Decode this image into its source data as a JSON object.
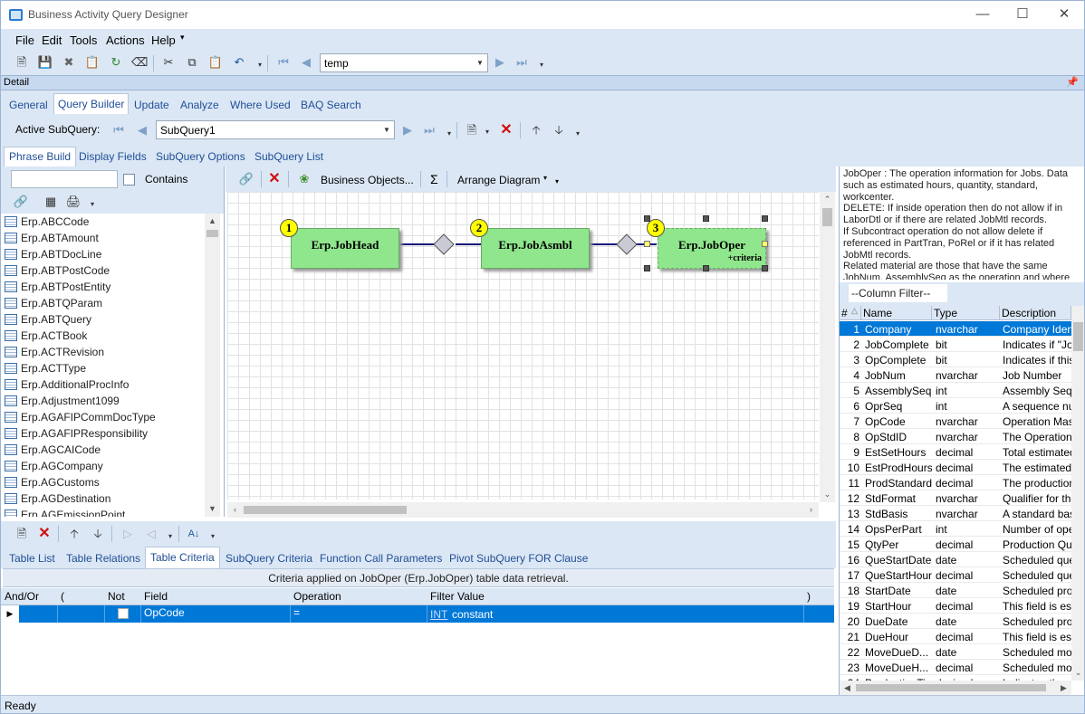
{
  "window": {
    "title": "Business Activity Query Designer"
  },
  "menu": [
    "File",
    "Edit",
    "Tools",
    "Actions",
    "Help"
  ],
  "toolbar": {
    "record_combo": "temp"
  },
  "detail_header": "Detail",
  "main_tabs": [
    "General",
    "Query Builder",
    "Update",
    "Analyze",
    "Where Used",
    "BAQ Search"
  ],
  "active_main_tab": "Query Builder",
  "subquery": {
    "label": "Active SubQuery:",
    "value": "SubQuery1"
  },
  "sub_tabs": [
    "Phrase Build",
    "Display Fields",
    "SubQuery Options",
    "SubQuery List"
  ],
  "active_sub_tab": "Phrase Build",
  "left": {
    "search_value": "",
    "contains_label": "Contains",
    "tables": [
      "Erp.ABCCode",
      "Erp.ABTAmount",
      "Erp.ABTDocLine",
      "Erp.ABTPostCode",
      "Erp.ABTPostEntity",
      "Erp.ABTQParam",
      "Erp.ABTQuery",
      "Erp.ACTBook",
      "Erp.ACTRevision",
      "Erp.ACTType",
      "Erp.AdditionalProcInfo",
      "Erp.Adjustment1099",
      "Erp.AGAFIPCommDocType",
      "Erp.AGAFIPResponsibility",
      "Erp.AGCAICode",
      "Erp.AGCompany",
      "Erp.AGCustoms",
      "Erp.AGDestination",
      "Erp.AGEmissionPoint"
    ]
  },
  "diagram": {
    "business_objects_label": "Business Objects...",
    "sigma": "Σ",
    "arrange_label": "Arrange Diagram",
    "nodes": [
      {
        "num": "1",
        "name": "Erp.JobHead",
        "extra": ""
      },
      {
        "num": "2",
        "name": "Erp.JobAsmbl",
        "extra": ""
      },
      {
        "num": "3",
        "name": "Erp.JobOper",
        "extra": "+criteria"
      }
    ]
  },
  "right": {
    "description": "JobOper : The operation information for Jobs.  Data such as estimated hours, quantity, standard, workcenter.\nDELETE: If inside operation then do not allow if in LaborDtl or if there are related JobMtl records.\nIf Subcontract operation do not allow delete if referenced in PartTran, PoRel or if it has related JobMtl records.\nRelated material are those that have the same JobNum, AssemblySeq as the operation and where",
    "column_filter": "--Column Filter--",
    "grid_headers": [
      "#",
      "Name",
      "Type",
      "Description"
    ],
    "rows": [
      [
        "1",
        "Company",
        "nvarchar",
        "Company Identifier"
      ],
      [
        "2",
        "JobComplete",
        "bit",
        "Indicates if \"Jo"
      ],
      [
        "3",
        "OpComplete",
        "bit",
        "Indicates if this"
      ],
      [
        "4",
        "JobNum",
        "nvarchar",
        "Job Number"
      ],
      [
        "5",
        "AssemblySeq",
        "int",
        "Assembly Seq"
      ],
      [
        "6",
        "OprSeq",
        "int",
        "A sequence nu"
      ],
      [
        "7",
        "OpCode",
        "nvarchar",
        "Operation Mas"
      ],
      [
        "8",
        "OpStdID",
        "nvarchar",
        "The Operation"
      ],
      [
        "9",
        "EstSetHours",
        "decimal",
        "Total estimated"
      ],
      [
        "10",
        "EstProdHours",
        "decimal",
        "The estimated"
      ],
      [
        "11",
        "ProdStandard",
        "decimal",
        "The production"
      ],
      [
        "12",
        "StdFormat",
        "nvarchar",
        "Qualifier for the"
      ],
      [
        "13",
        "StdBasis",
        "nvarchar",
        "A standard bas"
      ],
      [
        "14",
        "OpsPerPart",
        "int",
        "Number of ope"
      ],
      [
        "15",
        "QtyPer",
        "decimal",
        "Production Qu"
      ],
      [
        "16",
        "QueStartDate",
        "date",
        "Scheduled que"
      ],
      [
        "17",
        "QueStartHour",
        "decimal",
        "Scheduled que"
      ],
      [
        "18",
        "StartDate",
        "date",
        "Scheduled pro"
      ],
      [
        "19",
        "StartHour",
        "decimal",
        "This field is es"
      ],
      [
        "20",
        "DueDate",
        "date",
        "Scheduled pro"
      ],
      [
        "21",
        "DueHour",
        "decimal",
        "This field is es"
      ],
      [
        "22",
        "MoveDueD...",
        "date",
        "Scheduled mo"
      ],
      [
        "23",
        "MoveDueH...",
        "decimal",
        "Scheduled mo"
      ],
      [
        "24",
        "ProductionTi...",
        "decimal",
        "Indicates the"
      ]
    ]
  },
  "bottom": {
    "tabs": [
      "Table List",
      "Table Relations",
      "Table Criteria",
      "SubQuery Criteria",
      "Function Call Parameters",
      "Pivot SubQuery FOR Clause"
    ],
    "active_tab": "Table Criteria",
    "criteria_label": "Criteria applied on JobOper (Erp.JobOper)  table data retrieval.",
    "headers": [
      "And/Or",
      "(",
      "Not",
      "Field",
      "Operation",
      "Filter Value",
      ")"
    ],
    "row": {
      "andor": "",
      "open": "",
      "not": "",
      "field": "OpCode",
      "operation": "=",
      "filter_type": "INT",
      "filter_value": "constant",
      "close": ""
    }
  },
  "status": "Ready"
}
